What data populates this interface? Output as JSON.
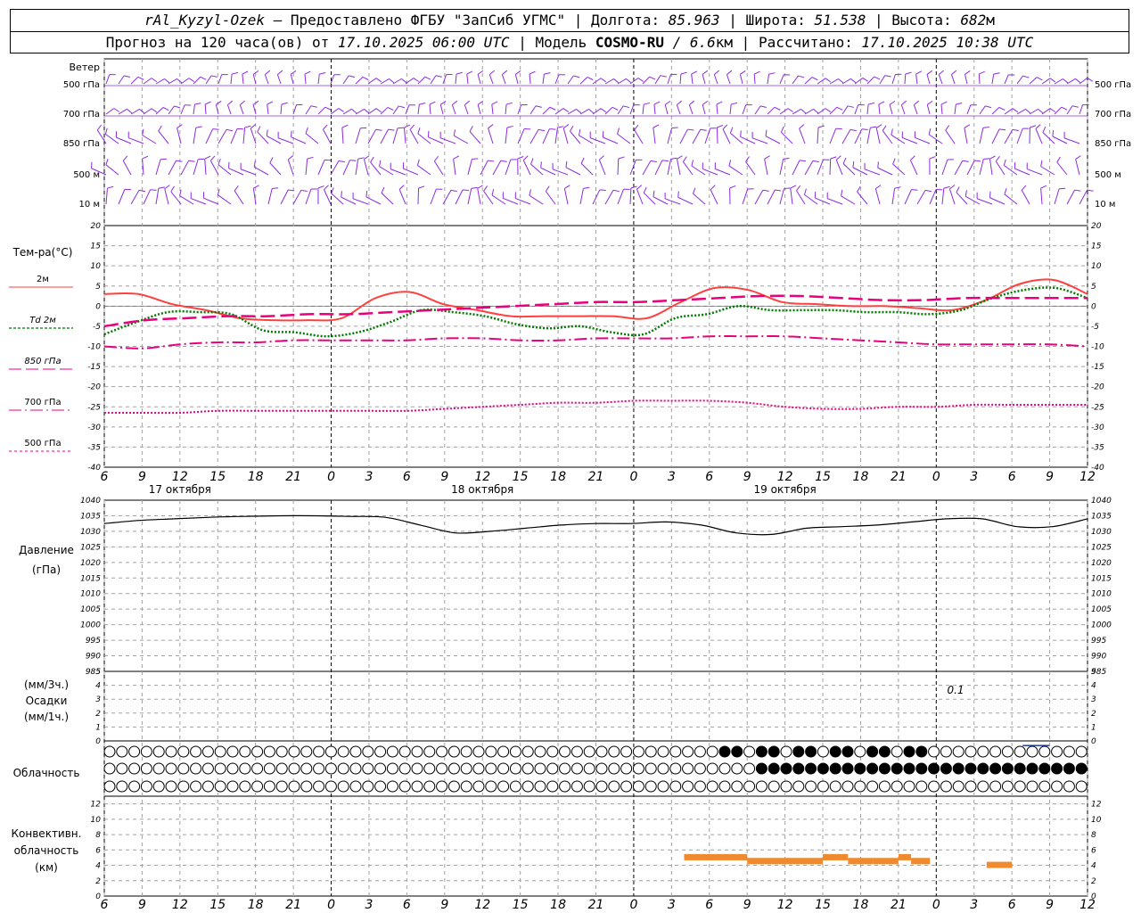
{
  "header": {
    "station": "rAl_Kyzyl-Ozek",
    "provider": "– Предоставлено ФГБУ \"ЗапСиб УГМС\"",
    "lon_label": "| Долгота:",
    "lon": "85.963",
    "lat_label": "| Широта:",
    "lat": "51.538",
    "alt_label": "| Высота:",
    "alt": "682",
    "alt_unit": "м",
    "forecast_label": "Прогноз на 120 часа(ов) от",
    "forecast_from": "17.10.2025 06:00 UTC",
    "model_label": "| Модель",
    "model": "COSMO-RU",
    "resolution": "/ 6.6",
    "res_unit": "км",
    "computed_label": "| Рассчитано:",
    "computed": "17.10.2025 10:38 UTC"
  },
  "colors": {
    "wind": "#8a2be2",
    "t2m": "#ff4040",
    "td2m": "#007a00",
    "t850": "#e8007d",
    "t700": "#e8007d",
    "t500": "#e8007d",
    "pressure": "#000000",
    "precip": "#1e3c9c",
    "convective": "#f08a30",
    "grid": "#a0a0a0"
  },
  "time_axis": {
    "hour_ticks": [
      "6",
      "9",
      "12",
      "15",
      "18",
      "21",
      "0",
      "3",
      "6",
      "9",
      "12",
      "15",
      "18",
      "21",
      "0",
      "3",
      "6",
      "9",
      "12",
      "15",
      "18",
      "21",
      "0",
      "3",
      "6",
      "9",
      "12"
    ],
    "day_labels": [
      "17 октября",
      "18 октября",
      "19 октября"
    ]
  },
  "wind_panel": {
    "title": "Ветер",
    "levels": [
      "500 гПа",
      "700 гПа",
      "850 гПа",
      "500 м",
      "10 м"
    ]
  },
  "temp_panel": {
    "title": "Тем-ра(°C)",
    "legend": [
      "2м",
      "Td 2м",
      "850 гПа",
      "700 гПа",
      "500 гПа"
    ],
    "y_ticks": [
      "20",
      "15",
      "10",
      "5",
      "0",
      "-5",
      "-10",
      "-15",
      "-20",
      "-25",
      "-30",
      "-35",
      "-40"
    ]
  },
  "pressure_panel": {
    "title": "Давление",
    "unit": "(гПа)",
    "y_ticks": [
      "1040",
      "1035",
      "1030",
      "1025",
      "1020",
      "1015",
      "1010",
      "1005",
      "1000",
      "995",
      "990",
      "985"
    ]
  },
  "precip_panel": {
    "unit_top": "(мм/3ч.)",
    "title": "Осадки",
    "unit_bottom": "(мм/1ч.)",
    "y_ticks": [
      "5",
      "4",
      "3",
      "2",
      "1",
      "0"
    ],
    "annotation": "0.1"
  },
  "cloud_panel": {
    "title": "Облачность"
  },
  "conv_panel": {
    "title_1": "Конвективн.",
    "title_2": "облачность",
    "unit": "(км)",
    "y_ticks": [
      "12",
      "10",
      "8",
      "6",
      "4",
      "2",
      "0"
    ]
  },
  "chart_data": {
    "type": "line",
    "x_hours": [
      0,
      3,
      6,
      9,
      12,
      15,
      18,
      21,
      24,
      27,
      30,
      33,
      36,
      39,
      42,
      45,
      48,
      51,
      54,
      57,
      60,
      63,
      66,
      69,
      72,
      75,
      78
    ],
    "series": [
      {
        "name": "2м",
        "unit": "°C",
        "values": [
          3,
          3,
          0.5,
          -1,
          -3,
          -3.5,
          -3.5,
          -3,
          2,
          3.5,
          0.5,
          -1,
          -2.5,
          -2.5,
          -2.5,
          -2.5,
          -3,
          1,
          4.5,
          4,
          1,
          0.5,
          0,
          0,
          -0.5,
          -1,
          1.5,
          5.5,
          6.5,
          3
        ]
      },
      {
        "name": "Td 2м",
        "unit": "°C",
        "values": [
          -7,
          -4,
          -1.5,
          -1.5,
          -2,
          -6,
          -6.5,
          -7.5,
          -6.5,
          -4,
          -1,
          -1.5,
          -2.5,
          -4.5,
          -5.5,
          -5,
          -6.5,
          -7,
          -3,
          -2,
          0,
          -1,
          -1,
          -1,
          -1.5,
          -1.5,
          -2,
          -1,
          2,
          4,
          4.5,
          2
        ]
      },
      {
        "name": "850 гПа",
        "unit": "°C",
        "values": [
          -5,
          -3.5,
          -3,
          -2.5,
          -2.5,
          -2,
          -2,
          -1.5,
          -1,
          -0.5,
          0,
          0.5,
          1,
          1,
          1.5,
          2,
          2.5,
          2.5,
          2,
          1.5,
          1.5,
          2,
          2,
          2,
          2
        ]
      },
      {
        "name": "700 гПа",
        "unit": "°C",
        "values": [
          -10,
          -10.5,
          -9.5,
          -9,
          -9,
          -8.5,
          -8.5,
          -8.5,
          -8.5,
          -8,
          -8,
          -8.5,
          -8.5,
          -8,
          -8,
          -8,
          -7.5,
          -7.5,
          -7.5,
          -8,
          -8.5,
          -9,
          -9.5,
          -9.5,
          -9.5,
          -9.5,
          -10
        ]
      },
      {
        "name": "500 гПа",
        "unit": "°C",
        "values": [
          -26.5,
          -26.5,
          -26.5,
          -26,
          -26,
          -26,
          -26,
          -26,
          -26,
          -25.5,
          -25,
          -24.5,
          -24,
          -24,
          -23.5,
          -23.5,
          -23.5,
          -24,
          -25,
          -25.5,
          -25.5,
          -25,
          -25,
          -24.5,
          -24.5,
          -24.5,
          -24.5
        ]
      },
      {
        "name": "Давление",
        "unit": "гПа",
        "values": [
          1032.5,
          1033.5,
          1034,
          1034.5,
          1034.8,
          1035,
          1035,
          1034.8,
          1034.5,
          1032,
          1029.5,
          1030,
          1031,
          1032,
          1032.5,
          1032.5,
          1033,
          1032,
          1029.5,
          1029,
          1031,
          1031.5,
          1032,
          1033,
          1034,
          1034,
          1031.5,
          1031.5,
          1034
        ]
      }
    ],
    "precip_mm": {
      "x": [
        0,
        3,
        6,
        9,
        12,
        15,
        18,
        21,
        24,
        27,
        30,
        33,
        36,
        39,
        42,
        45,
        48,
        51,
        54,
        57,
        60,
        63,
        66,
        69,
        72,
        75,
        78
      ],
      "values": [
        0,
        0,
        0,
        0,
        0,
        0,
        0,
        0,
        0,
        0,
        0,
        0,
        0,
        0,
        0,
        0,
        0,
        0,
        0,
        0,
        0,
        0,
        0,
        0,
        0.1,
        0,
        0
      ]
    },
    "cloud_cover_rows": {
      "upper": "ooooooooooooooooooooooooooooooooooooooooooooooooooooooooooooooooooooooooooooooooooooooooooooooooooooooooooooooooooooooooooooooooooooooooooooooo",
      "note": "cloud symbols rendered from the script"
    },
    "convective_cloud_km": {
      "segments": [
        [
          46,
          51,
          5
        ],
        [
          51,
          53,
          4.5
        ],
        [
          53,
          57,
          4.5
        ],
        [
          57,
          59,
          5
        ],
        [
          59,
          61,
          4.5
        ],
        [
          61,
          63,
          4.5
        ],
        [
          63,
          64,
          5
        ],
        [
          64,
          65.5,
          4.5
        ],
        [
          70,
          72,
          4
        ]
      ]
    },
    "ylim_temp": [
      -40,
      20
    ],
    "ylim_pressure": [
      985,
      1040
    ],
    "ylim_precip": [
      0,
      5
    ],
    "ylim_conv": [
      0,
      13
    ]
  }
}
